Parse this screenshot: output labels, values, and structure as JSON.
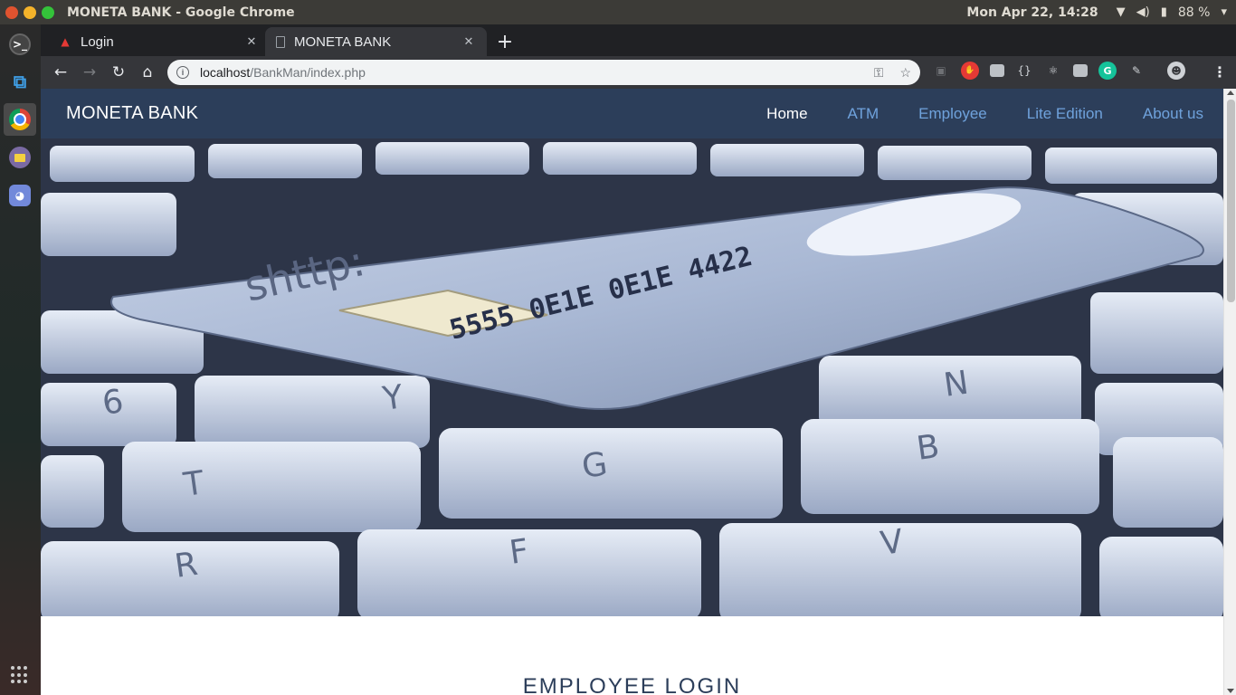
{
  "os": {
    "window_title": "MONETA BANK - Google Chrome",
    "clock": "Mon Apr 22, 14:28",
    "battery": "88 %"
  },
  "browser": {
    "tabs": [
      {
        "label": "Login"
      },
      {
        "label": "MONETA BANK"
      }
    ],
    "url_host": "localhost",
    "url_path": "/BankMan/index.php"
  },
  "site": {
    "brand": "MONETA BANK",
    "nav": [
      "Home",
      "ATM",
      "Employee",
      "Lite Edition",
      "About us"
    ],
    "hero_card": {
      "brand_text": "shttp:",
      "number_text": "5555 0E1E 0E1E 4422"
    },
    "section_title": "EMPLOYEE LOGIN"
  },
  "colors": {
    "navbar": "#2c3e5a",
    "nav_link": "#6fa2dc",
    "nav_link_active": "#ffffff"
  }
}
